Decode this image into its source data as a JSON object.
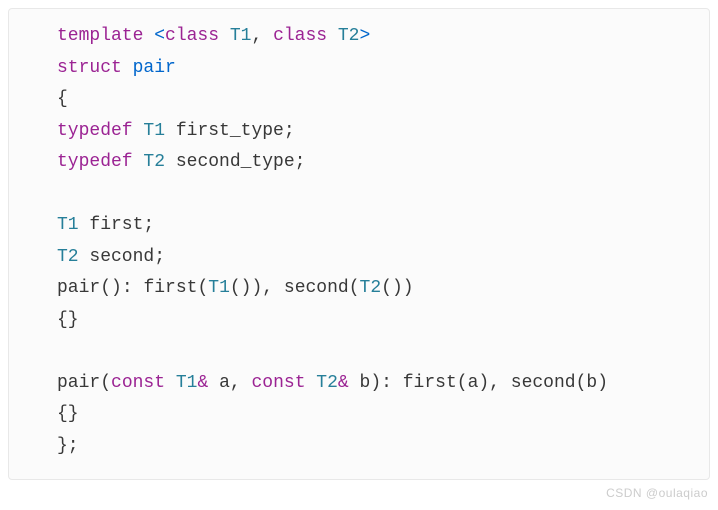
{
  "code": {
    "l1_template": "template",
    "l1_angle_open": " <",
    "l1_class1": "class",
    "l1_t1": " T1",
    "l1_comma": ",",
    "l1_class2": " class",
    "l1_t2": " T2",
    "l1_angle_close": ">",
    "l2_struct": "struct",
    "l2_pair": " pair",
    "l3_brace": "{",
    "l4_typedef": "typedef",
    "l4_t1": " T1 ",
    "l4_ident": "first_type",
    "l4_semi": ";",
    "l5_typedef": "typedef",
    "l5_t2": " T2 ",
    "l5_ident": "second_type",
    "l5_semi": ";",
    "l6_blank": "",
    "l7_t1": "T1 ",
    "l7_ident": "first",
    "l7_semi": ";",
    "l8_t2": "T2 ",
    "l8_ident": "second",
    "l8_semi": ";",
    "l9_pair": "pair",
    "l9_paren1": "()",
    "l9_colon": ": ",
    "l9_first": "first",
    "l9_p2o": "(",
    "l9_t1": "T1",
    "l9_p2i": "()",
    "l9_p2c": ")",
    "l9_comma": ", ",
    "l9_second": "second",
    "l9_p3o": "(",
    "l9_t2": "T2",
    "l9_p3i": "()",
    "l9_p3c": ")",
    "l10_braces": "{}",
    "l11_blank": "",
    "l12_pair": "pair",
    "l12_p1o": "(",
    "l12_const1": "const",
    "l12_t1": " T1",
    "l12_amp1": "&",
    "l12_a": " a",
    "l12_comma1": ",",
    "l12_const2": " const",
    "l12_t2": " T2",
    "l12_amp2": "&",
    "l12_b": " b",
    "l12_p1c": ")",
    "l12_colon": ": ",
    "l12_first": "first",
    "l12_p2": "(a)",
    "l12_comma2": ", ",
    "l12_second": "second",
    "l12_p3": "(b)",
    "l13_braces": "{}",
    "l14_close": "};"
  },
  "watermark": "CSDN @oulaqiao"
}
